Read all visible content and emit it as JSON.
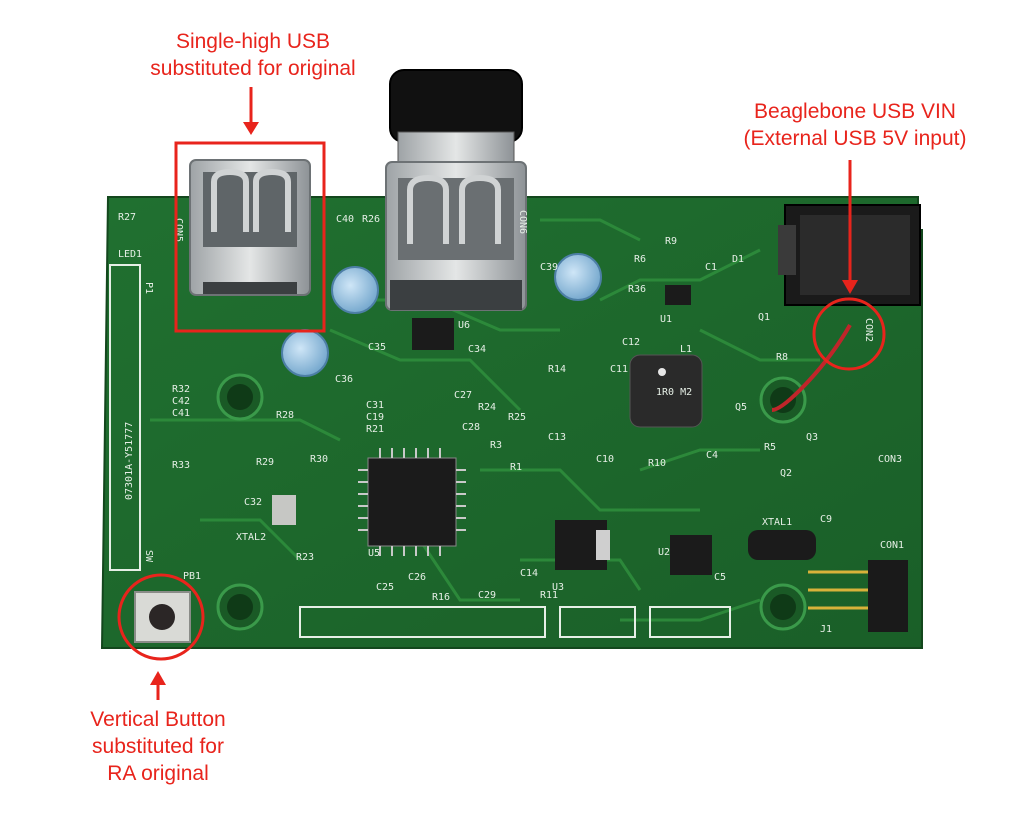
{
  "annotations": {
    "usb": {
      "line1": "Single-high USB",
      "line2": "substituted for original"
    },
    "vin": {
      "line1": "Beaglebone USB VIN",
      "line2": "(External USB 5V input)"
    },
    "button": {
      "line1": "Vertical Button",
      "line2": "substituted for",
      "line3": "RA original"
    }
  },
  "board_silkscreen": {
    "con5": "CON5",
    "con6": "CON6",
    "con2": "CON2",
    "con3": "CON3",
    "con1": "CON1",
    "p1": "P1",
    "led1": "LED1",
    "r27": "R27",
    "sw": "SW",
    "pb1": "PB1",
    "j1": "J1",
    "c40": "C40",
    "r26": "R26",
    "c39": "C39",
    "c36": "C36",
    "c35": "C35",
    "c34": "C34",
    "r36": "R36",
    "r9": "R9",
    "r6": "R6",
    "c1": "C1",
    "d1": "D1",
    "q1": "Q1",
    "c12": "C12",
    "c11": "C11",
    "r14": "R14",
    "l1": "L1",
    "inductor_value": "1R0 M2",
    "r8": "R8",
    "q5": "Q5",
    "r32": "R32",
    "c42": "C42",
    "c41": "C41",
    "r28": "R28",
    "r29": "R29",
    "r30": "R30",
    "c31": "C31",
    "c19": "C19",
    "r21": "R21",
    "c27": "C27",
    "c28": "C28",
    "r24": "R24",
    "r25": "R25",
    "r3": "R3",
    "c13": "C13",
    "c10": "C10",
    "r10": "R10",
    "c4": "C4",
    "q3": "Q3",
    "q2": "Q2",
    "r5": "R5",
    "r33": "R33",
    "c32": "C32",
    "xtal2": "XTAL2",
    "r23": "R23",
    "u5": "U5",
    "r1": "R1",
    "board_id": "07301A-Y51777",
    "c25": "C25",
    "c26": "C26",
    "r16": "R16",
    "c29": "C29",
    "c14": "C14",
    "r11": "R11",
    "u3": "U3",
    "u2": "U2",
    "c5": "C5",
    "xtal1": "XTAL1",
    "c9": "C9",
    "u6": "U6",
    "u1": "U1"
  },
  "colors": {
    "annotation": "#e8241c",
    "pcb": "#1f6b2c",
    "pcb_dark": "#164f21",
    "trace": "#2c8a3a",
    "silk": "#e6efe6",
    "pad": "#d6d8d2"
  },
  "icons": {
    "usb_a_receptacle": "usb-connector-icon",
    "push_button": "tactile-button-icon",
    "barrel_jack": "dc-jack-icon"
  }
}
